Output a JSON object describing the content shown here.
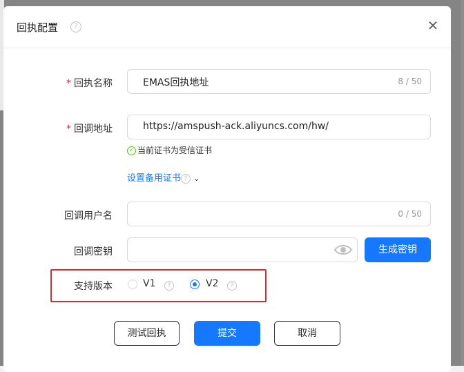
{
  "dialog": {
    "title": "回执配置",
    "help_glyph": "?",
    "close_glyph": "✕"
  },
  "form": {
    "name": {
      "label": "回执名称",
      "value": "EMAS回执地址",
      "count": "8 / 50",
      "required": "*"
    },
    "url": {
      "label": "回调地址",
      "value": "https://amspush-ack.aliyuncs.com/hw/",
      "required": "*"
    },
    "cert_status": "当前证书为受信证书",
    "backup_cert_link": "设置备用证书",
    "username": {
      "label": "回调用户名",
      "value": "",
      "count": "0 / 50"
    },
    "secret": {
      "label": "回调密钥",
      "value": "",
      "generate_label": "生成密钥"
    },
    "version": {
      "label": "支持版本",
      "options": [
        "V1",
        "V2"
      ],
      "selected": "V2"
    }
  },
  "footer": {
    "test_label": "测试回执",
    "submit_label": "提交",
    "cancel_label": "取消"
  },
  "colors": {
    "primary": "#1677ff",
    "required": "#f5222d",
    "highlight": "#e5252a",
    "success": "#52c41a"
  }
}
